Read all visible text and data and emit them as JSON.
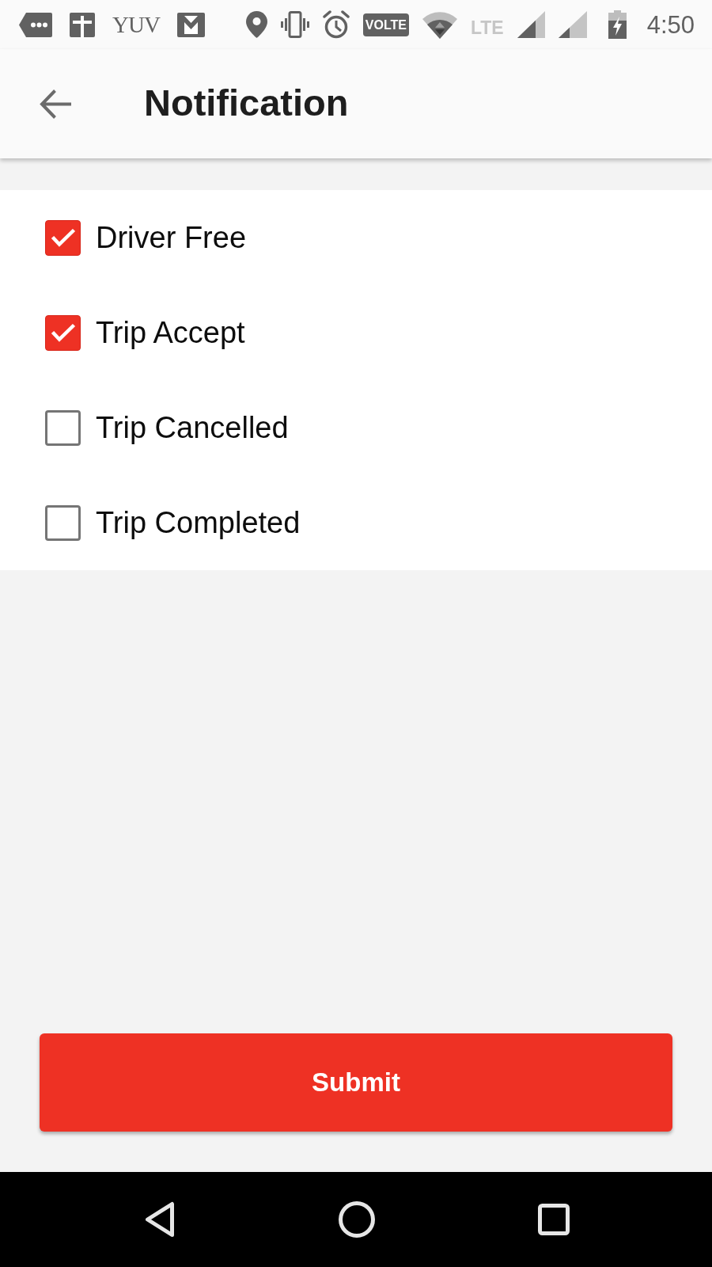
{
  "status_bar": {
    "notification_text": "YUV",
    "network_badge": "VOLTE",
    "network_type": "LTE",
    "time": "4:50"
  },
  "app_bar": {
    "title": "Notification"
  },
  "options": [
    {
      "label": "Driver Free",
      "checked": true
    },
    {
      "label": "Trip Accept",
      "checked": true
    },
    {
      "label": "Trip Cancelled",
      "checked": false
    },
    {
      "label": "Trip Completed",
      "checked": false
    }
  ],
  "submit_button": {
    "label": "Submit"
  }
}
